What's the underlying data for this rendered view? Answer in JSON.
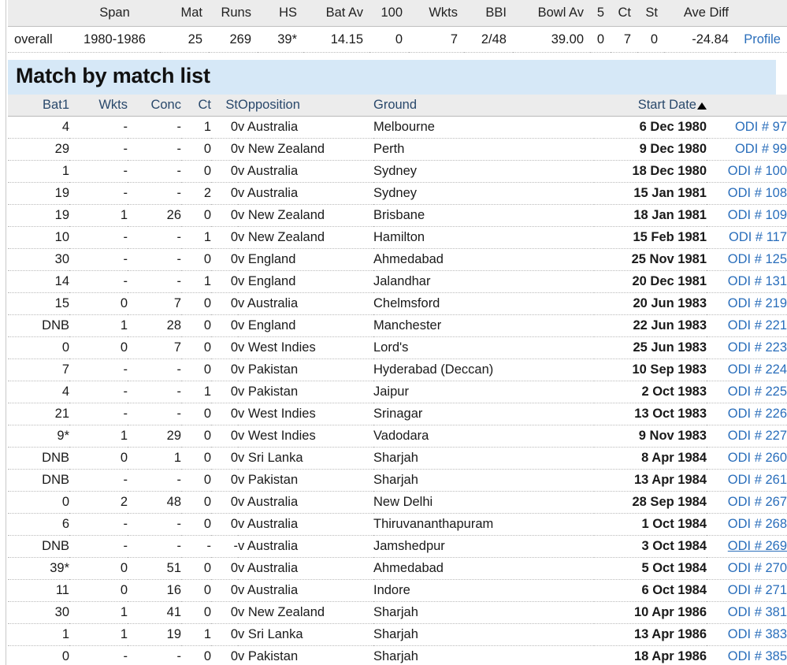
{
  "summary": {
    "headers": [
      "",
      "Span",
      "Mat",
      "Runs",
      "HS",
      "Bat Av",
      "100",
      "Wkts",
      "BBI",
      "Bowl Av",
      "5",
      "Ct",
      "St",
      "Ave Diff",
      ""
    ],
    "row": {
      "label": "overall",
      "span": "1980-1986",
      "mat": "25",
      "runs": "269",
      "hs": "39*",
      "bat_av": "14.15",
      "hundreds": "0",
      "wkts": "7",
      "bbi": "2/48",
      "bowl_av": "39.00",
      "five_wkts": "0",
      "ct": "7",
      "st": "0",
      "ave_diff": "-24.84",
      "profile_link": "Profile"
    }
  },
  "section": {
    "title": "Match by match list"
  },
  "matches": {
    "headers": {
      "bat1": "Bat1",
      "wkts": "Wkts",
      "conc": "Conc",
      "ct": "Ct",
      "st": "St",
      "opposition": "Opposition",
      "ground": "Ground",
      "start_date": "Start Date",
      "sort_direction": "ascending",
      "link": ""
    },
    "rows": [
      {
        "bat1": "4",
        "wkts": "-",
        "conc": "-",
        "ct": "1",
        "st": "0",
        "opposition": "v Australia",
        "ground": "Melbourne",
        "date": "6 Dec 1980",
        "link": "ODI # 97",
        "hovered": false
      },
      {
        "bat1": "29",
        "wkts": "-",
        "conc": "-",
        "ct": "0",
        "st": "0",
        "opposition": "v New Zealand",
        "ground": "Perth",
        "date": "9 Dec 1980",
        "link": "ODI # 99",
        "hovered": false
      },
      {
        "bat1": "1",
        "wkts": "-",
        "conc": "-",
        "ct": "0",
        "st": "0",
        "opposition": "v Australia",
        "ground": "Sydney",
        "date": "18 Dec 1980",
        "link": "ODI # 100",
        "hovered": false
      },
      {
        "bat1": "19",
        "wkts": "-",
        "conc": "-",
        "ct": "2",
        "st": "0",
        "opposition": "v Australia",
        "ground": "Sydney",
        "date": "15 Jan 1981",
        "link": "ODI # 108",
        "hovered": false
      },
      {
        "bat1": "19",
        "wkts": "1",
        "conc": "26",
        "ct": "0",
        "st": "0",
        "opposition": "v New Zealand",
        "ground": "Brisbane",
        "date": "18 Jan 1981",
        "link": "ODI # 109",
        "hovered": false
      },
      {
        "bat1": "10",
        "wkts": "-",
        "conc": "-",
        "ct": "1",
        "st": "0",
        "opposition": "v New Zealand",
        "ground": "Hamilton",
        "date": "15 Feb 1981",
        "link": "ODI # 117",
        "hovered": false
      },
      {
        "bat1": "30",
        "wkts": "-",
        "conc": "-",
        "ct": "0",
        "st": "0",
        "opposition": "v England",
        "ground": "Ahmedabad",
        "date": "25 Nov 1981",
        "link": "ODI # 125",
        "hovered": false
      },
      {
        "bat1": "14",
        "wkts": "-",
        "conc": "-",
        "ct": "1",
        "st": "0",
        "opposition": "v England",
        "ground": "Jalandhar",
        "date": "20 Dec 1981",
        "link": "ODI # 131",
        "hovered": false
      },
      {
        "bat1": "15",
        "wkts": "0",
        "conc": "7",
        "ct": "0",
        "st": "0",
        "opposition": "v Australia",
        "ground": "Chelmsford",
        "date": "20 Jun 1983",
        "link": "ODI # 219",
        "hovered": false
      },
      {
        "bat1": "DNB",
        "wkts": "1",
        "conc": "28",
        "ct": "0",
        "st": "0",
        "opposition": "v England",
        "ground": "Manchester",
        "date": "22 Jun 1983",
        "link": "ODI # 221",
        "hovered": false
      },
      {
        "bat1": "0",
        "wkts": "0",
        "conc": "7",
        "ct": "0",
        "st": "0",
        "opposition": "v West Indies",
        "ground": "Lord's",
        "date": "25 Jun 1983",
        "link": "ODI # 223",
        "hovered": false
      },
      {
        "bat1": "7",
        "wkts": "-",
        "conc": "-",
        "ct": "0",
        "st": "0",
        "opposition": "v Pakistan",
        "ground": "Hyderabad (Deccan)",
        "date": "10 Sep 1983",
        "link": "ODI # 224",
        "hovered": false
      },
      {
        "bat1": "4",
        "wkts": "-",
        "conc": "-",
        "ct": "1",
        "st": "0",
        "opposition": "v Pakistan",
        "ground": "Jaipur",
        "date": "2 Oct 1983",
        "link": "ODI # 225",
        "hovered": false
      },
      {
        "bat1": "21",
        "wkts": "-",
        "conc": "-",
        "ct": "0",
        "st": "0",
        "opposition": "v West Indies",
        "ground": "Srinagar",
        "date": "13 Oct 1983",
        "link": "ODI # 226",
        "hovered": false
      },
      {
        "bat1": "9*",
        "wkts": "1",
        "conc": "29",
        "ct": "0",
        "st": "0",
        "opposition": "v West Indies",
        "ground": "Vadodara",
        "date": "9 Nov 1983",
        "link": "ODI # 227",
        "hovered": false
      },
      {
        "bat1": "DNB",
        "wkts": "0",
        "conc": "1",
        "ct": "0",
        "st": "0",
        "opposition": "v Sri Lanka",
        "ground": "Sharjah",
        "date": "8 Apr 1984",
        "link": "ODI # 260",
        "hovered": false
      },
      {
        "bat1": "DNB",
        "wkts": "-",
        "conc": "-",
        "ct": "0",
        "st": "0",
        "opposition": "v Pakistan",
        "ground": "Sharjah",
        "date": "13 Apr 1984",
        "link": "ODI # 261",
        "hovered": false
      },
      {
        "bat1": "0",
        "wkts": "2",
        "conc": "48",
        "ct": "0",
        "st": "0",
        "opposition": "v Australia",
        "ground": "New Delhi",
        "date": "28 Sep 1984",
        "link": "ODI # 267",
        "hovered": false
      },
      {
        "bat1": "6",
        "wkts": "-",
        "conc": "-",
        "ct": "0",
        "st": "0",
        "opposition": "v Australia",
        "ground": "Thiruvananthapuram",
        "date": "1 Oct 1984",
        "link": "ODI # 268",
        "hovered": false
      },
      {
        "bat1": "DNB",
        "wkts": "-",
        "conc": "-",
        "ct": "-",
        "st": "-",
        "opposition": "v Australia",
        "ground": "Jamshedpur",
        "date": "3 Oct 1984",
        "link": "ODI # 269",
        "hovered": true
      },
      {
        "bat1": "39*",
        "wkts": "0",
        "conc": "51",
        "ct": "0",
        "st": "0",
        "opposition": "v Australia",
        "ground": "Ahmedabad",
        "date": "5 Oct 1984",
        "link": "ODI # 270",
        "hovered": false
      },
      {
        "bat1": "11",
        "wkts": "0",
        "conc": "16",
        "ct": "0",
        "st": "0",
        "opposition": "v Australia",
        "ground": "Indore",
        "date": "6 Oct 1984",
        "link": "ODI # 271",
        "hovered": false
      },
      {
        "bat1": "30",
        "wkts": "1",
        "conc": "41",
        "ct": "0",
        "st": "0",
        "opposition": "v New Zealand",
        "ground": "Sharjah",
        "date": "10 Apr 1986",
        "link": "ODI # 381",
        "hovered": false
      },
      {
        "bat1": "1",
        "wkts": "1",
        "conc": "19",
        "ct": "1",
        "st": "0",
        "opposition": "v Sri Lanka",
        "ground": "Sharjah",
        "date": "13 Apr 1986",
        "link": "ODI # 383",
        "hovered": false
      },
      {
        "bat1": "0",
        "wkts": "-",
        "conc": "-",
        "ct": "0",
        "st": "0",
        "opposition": "v Pakistan",
        "ground": "Sharjah",
        "date": "18 Apr 1986",
        "link": "ODI # 385",
        "hovered": false
      }
    ]
  },
  "colors": {
    "link": "#2a6ebb",
    "banner_bg": "#d6e8f7",
    "header_bg": "#ececec",
    "header_text": "#29486b"
  }
}
